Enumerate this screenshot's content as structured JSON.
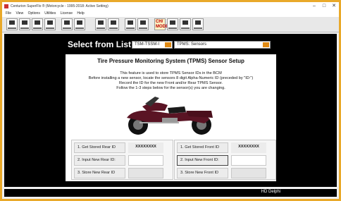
{
  "window": {
    "title": "Centurion SuperFlo ® (Motorcycle - 1995-2018: Active Setting)"
  },
  "menu": [
    "File",
    "View",
    "Options",
    "Utilities",
    "License",
    "Help"
  ],
  "toolbar": {
    "ch_label": "CH/",
    "ch_label2": "MODE"
  },
  "selector": {
    "label": "Select from List:",
    "dropdown1": "TSM-TSSM-I",
    "dropdown2": "TPMS: Sensors"
  },
  "panel": {
    "title": "Tire Pressure Monitoring System (TPMS) Sensor Setup",
    "lines": [
      "This feature is used to store TPMS Sensor IDs in the BCM",
      "Before installing a new sensor, locate the sensors 8 digit Alpha-Numeric ID (preceded by \"ID:\")",
      "Record the ID for the new Front and/or Rear TPMS Sensor.",
      "Follow the 1-3 steps below for the sensor(s) you are changing."
    ],
    "rear": {
      "get": "1.  Get Stored Rear ID",
      "get_value": "XXXXXXXX",
      "input": "2.  Input New Rear ID:",
      "input_value": "",
      "store": "3.  Store New Rear ID"
    },
    "front": {
      "get": "1.  Get Stored Front ID",
      "get_value": "XXXXXXXX",
      "input": "2.  Input New Front ID:",
      "input_value": "",
      "store": "3.  Store New Front ID"
    }
  },
  "status": {
    "text": "HD Delphi"
  },
  "colors": {
    "frame": "#e9a92a",
    "accent": "#e08a14",
    "bike": "#5a1424"
  }
}
